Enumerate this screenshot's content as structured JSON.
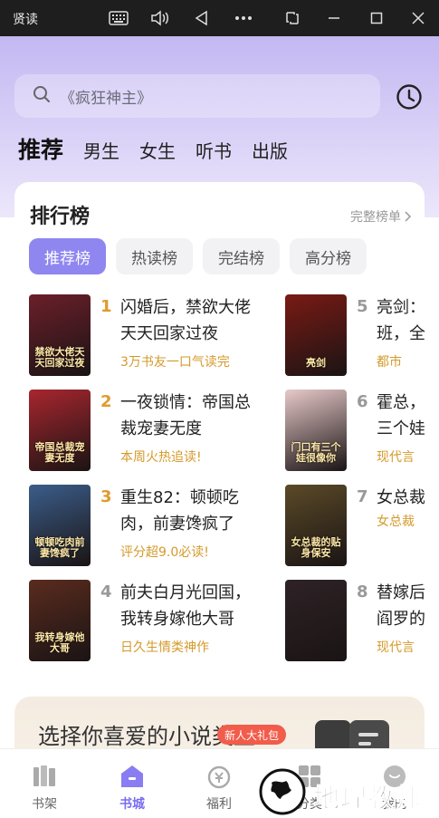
{
  "titlebar": {
    "app_name": "贤读",
    "icons": [
      "keyboard-icon",
      "volume-icon",
      "back-icon",
      "more-icon",
      "screenshot-icon",
      "minimize-icon",
      "maximize-icon",
      "close-icon"
    ]
  },
  "search": {
    "placeholder": "《疯狂神主》"
  },
  "top_tabs": [
    {
      "label": "推荐",
      "active": true
    },
    {
      "label": "男生"
    },
    {
      "label": "女生"
    },
    {
      "label": "听书"
    },
    {
      "label": "出版"
    }
  ],
  "rank": {
    "title": "排行榜",
    "more": "完整榜单",
    "chips": [
      {
        "label": "推荐榜",
        "active": true
      },
      {
        "label": "热读榜"
      },
      {
        "label": "完结榜"
      },
      {
        "label": "高分榜"
      }
    ],
    "books": [
      {
        "rank": "1",
        "title_line1": "闪婚后，禁欲大佬",
        "title_line2": "天天回家过夜",
        "tag": "3万书友一口气读完",
        "cover_text": "禁欲大佬天天回家过夜",
        "cover_color": "#6b1f2a"
      },
      {
        "rank": "2",
        "title_line1": "一夜锁情：帝国总",
        "title_line2": "裁宠妻无度",
        "tag": "本周火热追读!",
        "cover_text": "帝国总裁宠妻无度",
        "cover_color": "#a8262e"
      },
      {
        "rank": "3",
        "title_line1": "重生82：顿顿吃",
        "title_line2": "肉，前妻馋疯了",
        "tag": "评分超9.0必读!",
        "cover_text": "顿顿吃肉前妻馋疯了",
        "cover_color": "#3b5d8a"
      },
      {
        "rank": "4",
        "title_line1": "前夫白月光回国，",
        "title_line2": "我转身嫁他大哥",
        "tag": "日久生情类神作",
        "cover_text": "我转身嫁他大哥",
        "cover_color": "#5a2b1e"
      },
      {
        "rank": "5",
        "title_line1": "亮剑：",
        "title_line2": "班，全",
        "tag": "都市",
        "cover_text": "亮剑",
        "cover_color": "#7a1a14"
      },
      {
        "rank": "6",
        "title_line1": "霍总，",
        "title_line2": "三个娃",
        "tag": "现代言",
        "cover_text": "门口有三个娃很像你",
        "cover_color": "#e8c9c9"
      },
      {
        "rank": "7",
        "title_line1": "女总裁",
        "title_line2": "",
        "tag": "女总裁",
        "cover_text": "女总裁的贴身保安",
        "cover_color": "#5b4a28"
      },
      {
        "rank": "8",
        "title_line1": "替嫁后",
        "title_line2": "阎罗的",
        "tag": "现代言",
        "cover_text": "",
        "cover_color": "#2e2226"
      }
    ]
  },
  "category_banner": {
    "title": "选择你喜爱的小说类型"
  },
  "bottom_nav": [
    {
      "label": "书架",
      "icon": "bookshelf-icon"
    },
    {
      "label": "书城",
      "icon": "bookstore-icon",
      "active": true
    },
    {
      "label": "福利",
      "icon": "welfare-icon"
    },
    {
      "label": "分类",
      "icon": "category-icon"
    },
    {
      "label": "我的",
      "icon": "profile-icon"
    }
  ],
  "badge": "新人大礼包",
  "watermark": {
    "text": "地理教师"
  },
  "colors": {
    "accent": "#8f86f0",
    "rank_top": "#e09a2e",
    "rank_other": "#999999",
    "tag": "#d49a2b"
  }
}
